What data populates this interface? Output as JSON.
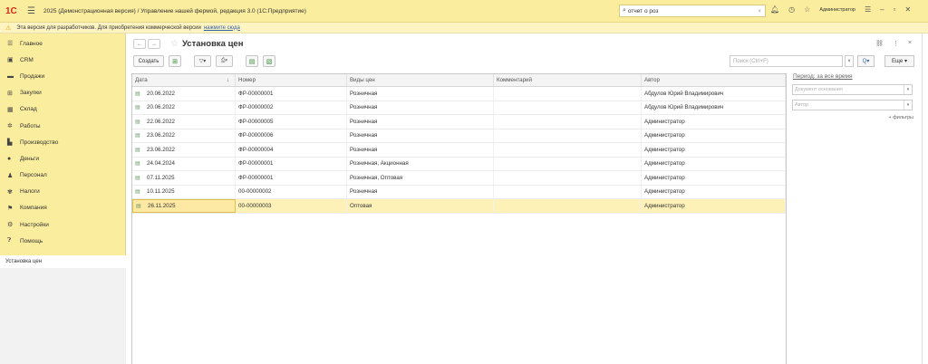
{
  "titlebar": {
    "logo": "1С",
    "title": "2025 (Демонстрационная версия) / Управление нашей фермой, редакция 3.0  (1С:Предприятие)",
    "search_value": "отчет о роз",
    "user": "Администратор"
  },
  "notice": {
    "text": "Эта версия для разработчиков. Для приобретения коммерческой версии",
    "link": "нажмите сюда"
  },
  "sidebar": {
    "items": [
      {
        "label": "Главное",
        "icon": "menu-lines-icon"
      },
      {
        "label": "CRM",
        "icon": "crm-icon"
      },
      {
        "label": "Продажи",
        "icon": "sales-icon"
      },
      {
        "label": "Закупки",
        "icon": "purchases-icon"
      },
      {
        "label": "Склад",
        "icon": "warehouse-icon"
      },
      {
        "label": "Работы",
        "icon": "works-icon"
      },
      {
        "label": "Производство",
        "icon": "production-icon"
      },
      {
        "label": "Деньги",
        "icon": "money-icon"
      },
      {
        "label": "Персонал",
        "icon": "personnel-icon"
      },
      {
        "label": "Налоги",
        "icon": "taxes-icon"
      },
      {
        "label": "Компания",
        "icon": "company-flag-icon"
      },
      {
        "label": "Настройки",
        "icon": "gear-icon"
      },
      {
        "label": "Помощь",
        "icon": "help-icon"
      }
    ],
    "open_window": "Установка цен"
  },
  "page": {
    "title": "Установка цен"
  },
  "toolbar": {
    "create_label": "Создать",
    "search_placeholder": "Поиск (Ctrl+F)",
    "search_btn": "Q",
    "more_label": "Еще"
  },
  "grid": {
    "columns": [
      "Дата",
      "Номер",
      "Виды цен",
      "Комментарий",
      "Автор"
    ],
    "rows": [
      {
        "date": "20.06.2022",
        "number": "ФР-00000001",
        "types": "Розничная",
        "comment": "",
        "author": "Абдулов Юрий Владимирович"
      },
      {
        "date": "20.06.2022",
        "number": "ФР-00000002",
        "types": "Розничная",
        "comment": "",
        "author": "Абдулов Юрий Владимирович"
      },
      {
        "date": "22.06.2022",
        "number": "ФР-00000005",
        "types": "Розничная",
        "comment": "",
        "author": "Администратор"
      },
      {
        "date": "23.06.2022",
        "number": "ФР-00000006",
        "types": "Розничная",
        "comment": "",
        "author": "Администратор"
      },
      {
        "date": "23.06.2022",
        "number": "ФР-00000004",
        "types": "Розничная",
        "comment": "",
        "author": "Администратор"
      },
      {
        "date": "24.04.2024",
        "number": "ФР-00000001",
        "types": "Розничная, Акционная",
        "comment": "",
        "author": "Администратор"
      },
      {
        "date": "07.11.2025",
        "number": "ФР-00000001",
        "types": "Розничная, Оптовая",
        "comment": "",
        "author": "Администратор"
      },
      {
        "date": "10.11.2025",
        "number": "00-00000002",
        "types": "Розничная",
        "comment": "",
        "author": "Администратор"
      },
      {
        "date": "26.11.2025",
        "number": "00-00000003",
        "types": "Оптовая",
        "comment": "",
        "author": "Администратор"
      }
    ]
  },
  "side_panel": {
    "period": "Период: за все время",
    "doc_base_placeholder": "Документ основания",
    "author_placeholder": "Автор",
    "filters": "+ фильтры"
  },
  "colors": {
    "accent_yellow": "#fbed9e",
    "selected_row": "#fdf1b8",
    "link_blue": "#3563a9"
  }
}
